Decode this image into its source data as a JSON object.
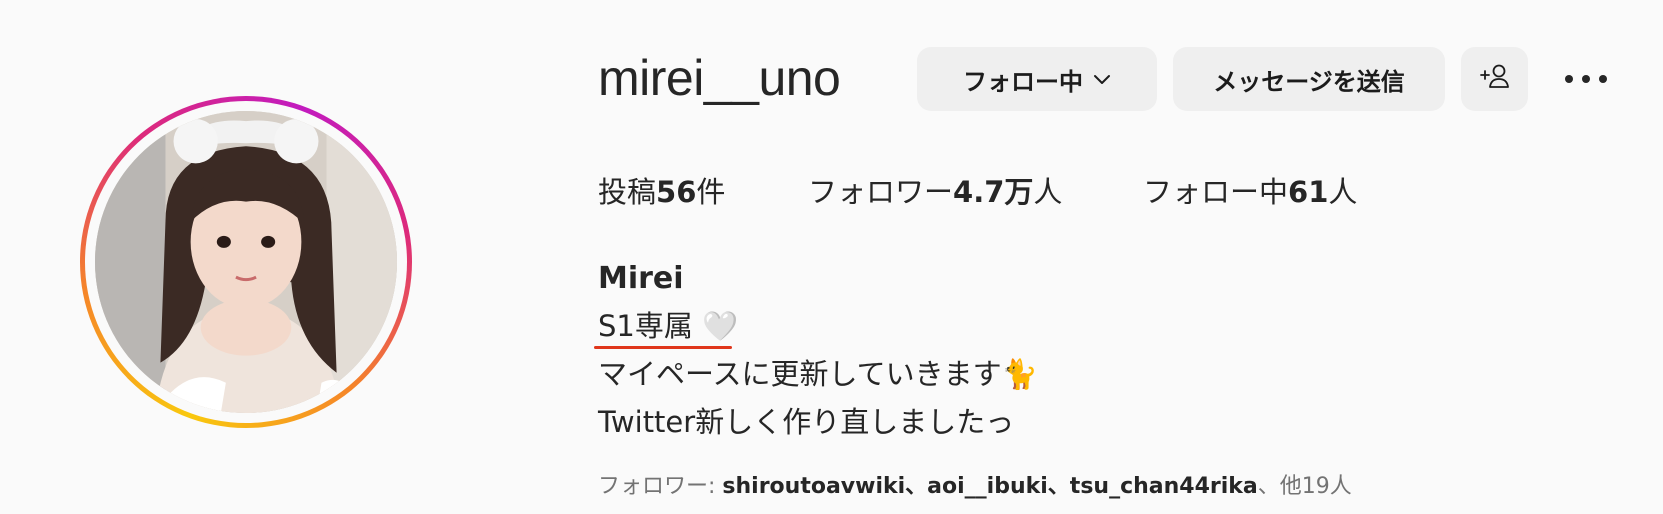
{
  "profile": {
    "username": "mirei__uno",
    "full_name": "Mirei",
    "avatar": "profile-photo"
  },
  "actions": {
    "follow_label": "フォロー中",
    "message_label": "メッセージを送信",
    "add_user_icon": "add-user-icon",
    "more_icon": "more-icon"
  },
  "stats": {
    "posts_prefix": "投稿",
    "posts_value": "56",
    "posts_suffix": "件",
    "followers_prefix": "フォロワー",
    "followers_value": "4.7万",
    "followers_suffix": "人",
    "following_prefix": "フォロー中",
    "following_value": "61",
    "following_suffix": "人"
  },
  "bio": {
    "line1": "S1専属 🤍",
    "line2": "マイペースに更新していきます🐈",
    "line3": "Twitter新しく作り直しましたっ"
  },
  "followed_by": {
    "prefix": "フォロワー: ",
    "names": "shiroutoavwiki、aoi__ibuki、tsu_chan44rika",
    "suffix": "、他19人"
  },
  "colors": {
    "ring_gradient": [
      "#f9c80e",
      "#f58529",
      "#dd2a7b",
      "#c21bbf"
    ],
    "underline": "#e0361b",
    "button_bg": "#efefef"
  }
}
